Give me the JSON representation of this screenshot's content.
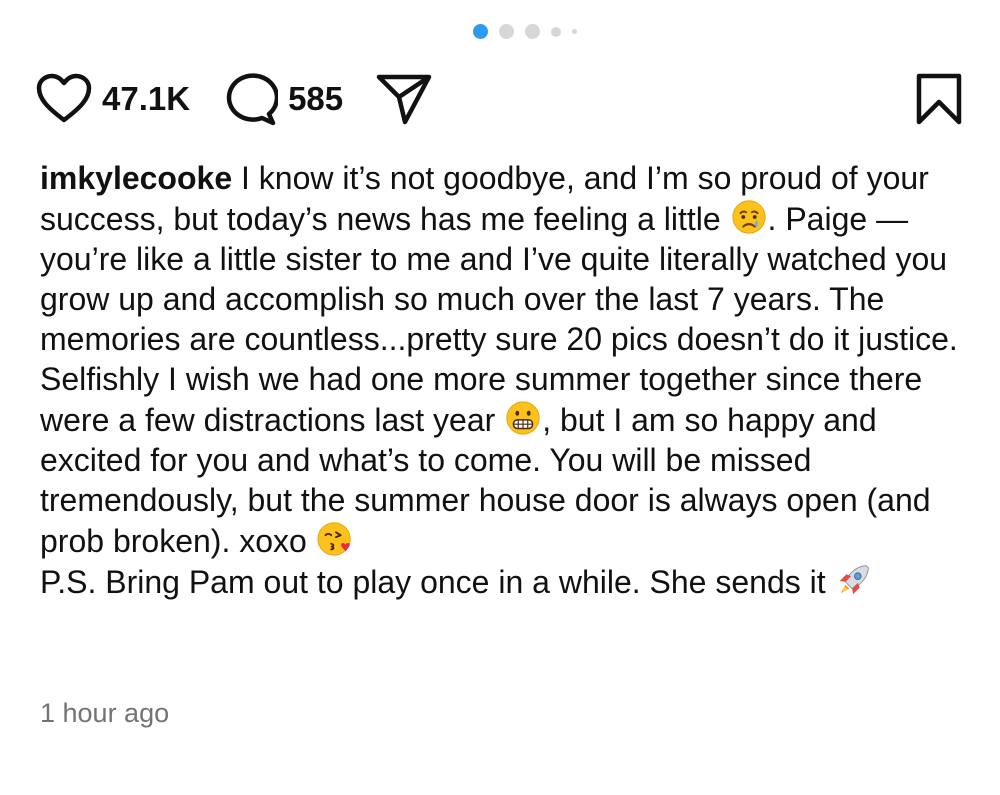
{
  "carousel": {
    "dot_count": 5,
    "active_index": 0,
    "active_color": "#2d9bf0"
  },
  "actions": {
    "like_count": "47.1K",
    "comment_count": "585",
    "like_icon": "heart-icon",
    "comment_icon": "comment-bubble-icon",
    "share_icon": "paper-plane-icon",
    "save_icon": "bookmark-icon"
  },
  "caption": {
    "username": "imkylecooke",
    "seg1": " I know it’s not goodbye, and I’m so proud of your success, but today’s news has me feeling a little ",
    "emoji1": "crying-face-emoji",
    "seg2": ". Paige — you’re like a little sister to me and I’ve quite literally watched you grow up and accomplish so much over the last 7 years. The memories are countless...pretty sure 20 pics doesn’t do it justice. Selfishly I wish we had one more summer together since there were a few distractions last year ",
    "emoji2": "grimacing-face-emoji",
    "seg3": ", but I am so happy and excited for you and what’s to come. You will be missed tremendously, but the summer house door is always open (and prob broken). xoxo ",
    "emoji3": "face-blowing-kiss-emoji",
    "ps": "P.S. Bring Pam out to play once in a while. She sends it ",
    "emoji4": "rocket-emoji"
  },
  "timestamp": "1 hour ago"
}
